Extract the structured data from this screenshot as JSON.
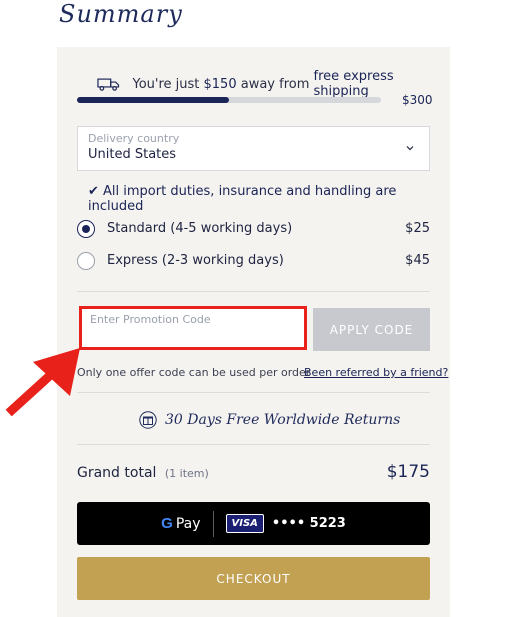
{
  "summary": {
    "title": "Summary"
  },
  "shipping": {
    "text_prefix": "You're just ",
    "amount": "$150",
    "text_mid": " away from ",
    "target": "free express shipping",
    "progress": 0.5,
    "threshold": "$300"
  },
  "delivery": {
    "label": "Delivery country",
    "value": "United States",
    "duties": "✔ All import duties, insurance and handling are included"
  },
  "options": [
    {
      "label": "Standard (4-5 working days)",
      "price": "$25",
      "selected": true
    },
    {
      "label": "Express (2-3 working days)",
      "price": "$45",
      "selected": false
    }
  ],
  "promo": {
    "placeholder": "Enter Promotion Code",
    "apply_label": "APPLY CODE",
    "note": "Only one offer code can be used per order",
    "referred_link": "Been referred by a friend?"
  },
  "returns": {
    "text": "30 Days Free Worldwide Returns"
  },
  "total": {
    "label": "Grand total",
    "items": "(1 item)",
    "value": "$175"
  },
  "gpay": {
    "pay_label": "Pay",
    "card_brand": "VISA",
    "card_number": "•••• 5223"
  },
  "checkout": {
    "label": "CHECKOUT"
  },
  "colors": {
    "navy": "#1a2456",
    "gold": "#c3a153",
    "highlight_red": "#e8221b"
  }
}
